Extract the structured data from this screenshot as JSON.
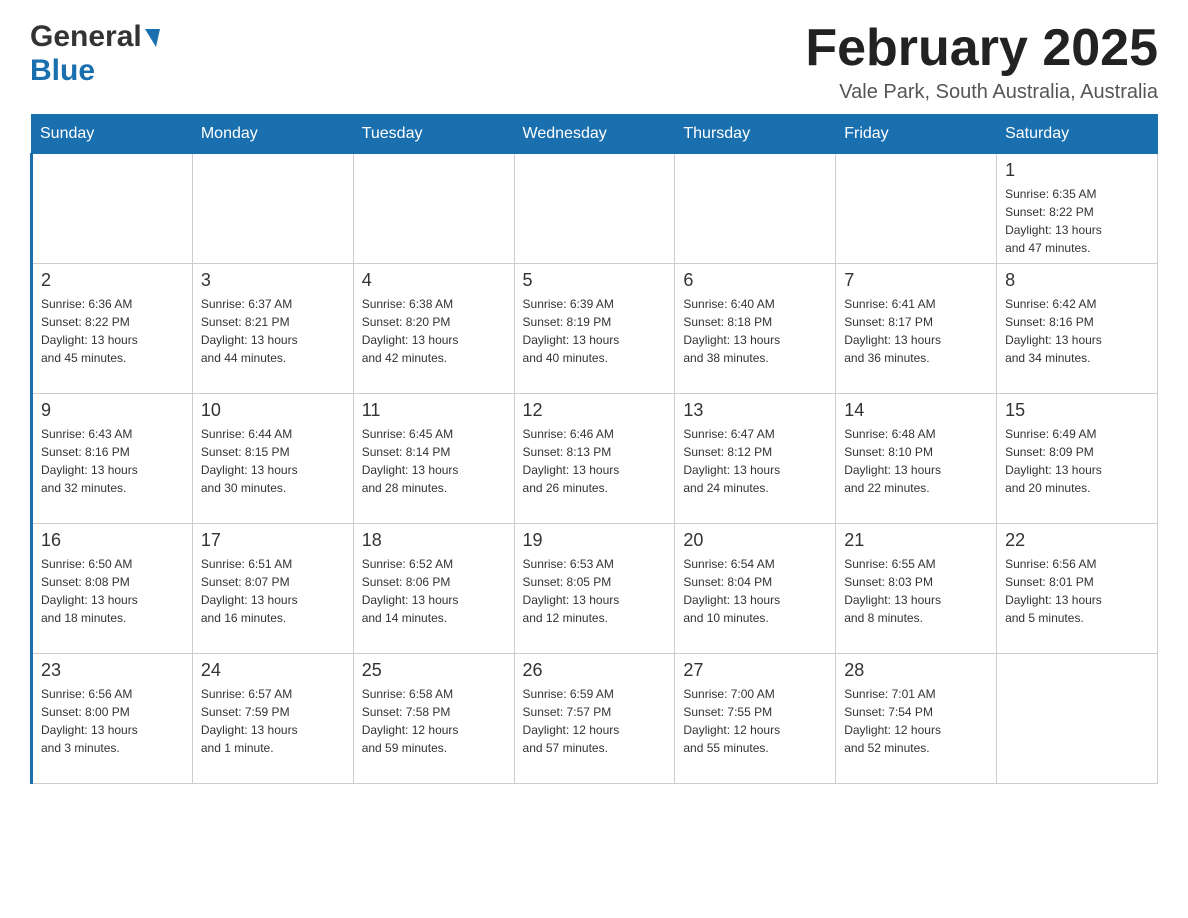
{
  "header": {
    "logo_general": "General",
    "logo_blue": "Blue",
    "month_title": "February 2025",
    "location": "Vale Park, South Australia, Australia"
  },
  "days_of_week": [
    "Sunday",
    "Monday",
    "Tuesday",
    "Wednesday",
    "Thursday",
    "Friday",
    "Saturday"
  ],
  "weeks": [
    {
      "days": [
        {
          "number": "",
          "info": ""
        },
        {
          "number": "",
          "info": ""
        },
        {
          "number": "",
          "info": ""
        },
        {
          "number": "",
          "info": ""
        },
        {
          "number": "",
          "info": ""
        },
        {
          "number": "",
          "info": ""
        },
        {
          "number": "1",
          "info": "Sunrise: 6:35 AM\nSunset: 8:22 PM\nDaylight: 13 hours\nand 47 minutes."
        }
      ]
    },
    {
      "days": [
        {
          "number": "2",
          "info": "Sunrise: 6:36 AM\nSunset: 8:22 PM\nDaylight: 13 hours\nand 45 minutes."
        },
        {
          "number": "3",
          "info": "Sunrise: 6:37 AM\nSunset: 8:21 PM\nDaylight: 13 hours\nand 44 minutes."
        },
        {
          "number": "4",
          "info": "Sunrise: 6:38 AM\nSunset: 8:20 PM\nDaylight: 13 hours\nand 42 minutes."
        },
        {
          "number": "5",
          "info": "Sunrise: 6:39 AM\nSunset: 8:19 PM\nDaylight: 13 hours\nand 40 minutes."
        },
        {
          "number": "6",
          "info": "Sunrise: 6:40 AM\nSunset: 8:18 PM\nDaylight: 13 hours\nand 38 minutes."
        },
        {
          "number": "7",
          "info": "Sunrise: 6:41 AM\nSunset: 8:17 PM\nDaylight: 13 hours\nand 36 minutes."
        },
        {
          "number": "8",
          "info": "Sunrise: 6:42 AM\nSunset: 8:16 PM\nDaylight: 13 hours\nand 34 minutes."
        }
      ]
    },
    {
      "days": [
        {
          "number": "9",
          "info": "Sunrise: 6:43 AM\nSunset: 8:16 PM\nDaylight: 13 hours\nand 32 minutes."
        },
        {
          "number": "10",
          "info": "Sunrise: 6:44 AM\nSunset: 8:15 PM\nDaylight: 13 hours\nand 30 minutes."
        },
        {
          "number": "11",
          "info": "Sunrise: 6:45 AM\nSunset: 8:14 PM\nDaylight: 13 hours\nand 28 minutes."
        },
        {
          "number": "12",
          "info": "Sunrise: 6:46 AM\nSunset: 8:13 PM\nDaylight: 13 hours\nand 26 minutes."
        },
        {
          "number": "13",
          "info": "Sunrise: 6:47 AM\nSunset: 8:12 PM\nDaylight: 13 hours\nand 24 minutes."
        },
        {
          "number": "14",
          "info": "Sunrise: 6:48 AM\nSunset: 8:10 PM\nDaylight: 13 hours\nand 22 minutes."
        },
        {
          "number": "15",
          "info": "Sunrise: 6:49 AM\nSunset: 8:09 PM\nDaylight: 13 hours\nand 20 minutes."
        }
      ]
    },
    {
      "days": [
        {
          "number": "16",
          "info": "Sunrise: 6:50 AM\nSunset: 8:08 PM\nDaylight: 13 hours\nand 18 minutes."
        },
        {
          "number": "17",
          "info": "Sunrise: 6:51 AM\nSunset: 8:07 PM\nDaylight: 13 hours\nand 16 minutes."
        },
        {
          "number": "18",
          "info": "Sunrise: 6:52 AM\nSunset: 8:06 PM\nDaylight: 13 hours\nand 14 minutes."
        },
        {
          "number": "19",
          "info": "Sunrise: 6:53 AM\nSunset: 8:05 PM\nDaylight: 13 hours\nand 12 minutes."
        },
        {
          "number": "20",
          "info": "Sunrise: 6:54 AM\nSunset: 8:04 PM\nDaylight: 13 hours\nand 10 minutes."
        },
        {
          "number": "21",
          "info": "Sunrise: 6:55 AM\nSunset: 8:03 PM\nDaylight: 13 hours\nand 8 minutes."
        },
        {
          "number": "22",
          "info": "Sunrise: 6:56 AM\nSunset: 8:01 PM\nDaylight: 13 hours\nand 5 minutes."
        }
      ]
    },
    {
      "days": [
        {
          "number": "23",
          "info": "Sunrise: 6:56 AM\nSunset: 8:00 PM\nDaylight: 13 hours\nand 3 minutes."
        },
        {
          "number": "24",
          "info": "Sunrise: 6:57 AM\nSunset: 7:59 PM\nDaylight: 13 hours\nand 1 minute."
        },
        {
          "number": "25",
          "info": "Sunrise: 6:58 AM\nSunset: 7:58 PM\nDaylight: 12 hours\nand 59 minutes."
        },
        {
          "number": "26",
          "info": "Sunrise: 6:59 AM\nSunset: 7:57 PM\nDaylight: 12 hours\nand 57 minutes."
        },
        {
          "number": "27",
          "info": "Sunrise: 7:00 AM\nSunset: 7:55 PM\nDaylight: 12 hours\nand 55 minutes."
        },
        {
          "number": "28",
          "info": "Sunrise: 7:01 AM\nSunset: 7:54 PM\nDaylight: 12 hours\nand 52 minutes."
        },
        {
          "number": "",
          "info": ""
        }
      ]
    }
  ]
}
